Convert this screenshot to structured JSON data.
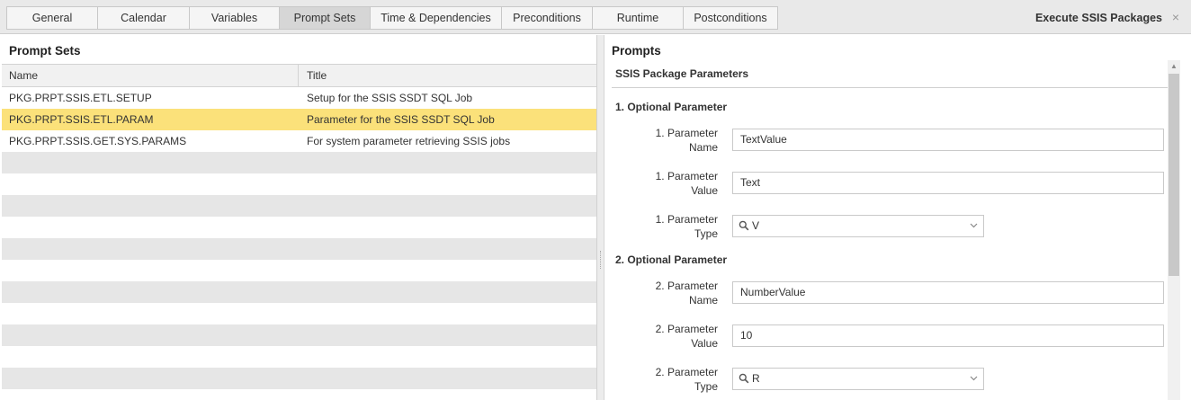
{
  "tabs": [
    {
      "label": "General"
    },
    {
      "label": "Calendar"
    },
    {
      "label": "Variables"
    },
    {
      "label": "Prompt Sets",
      "active": true
    },
    {
      "label": "Time & Dependencies"
    },
    {
      "label": "Preconditions"
    },
    {
      "label": "Runtime"
    },
    {
      "label": "Postconditions"
    }
  ],
  "window": {
    "title": "Execute SSIS Packages",
    "close_label": "×"
  },
  "prompt_sets": {
    "title": "Prompt Sets",
    "columns": {
      "name": "Name",
      "title": "Title"
    },
    "rows": [
      {
        "name": "PKG.PRPT.SSIS.ETL.SETUP",
        "title": "Setup for the SSIS SSDT SQL Job"
      },
      {
        "name": "PKG.PRPT.SSIS.ETL.PARAM",
        "title": "Parameter for the SSIS SSDT SQL Job",
        "selected": true
      },
      {
        "name": "PKG.PRPT.SSIS.GET.SYS.PARAMS",
        "title": "For system parameter retrieving SSIS jobs"
      }
    ]
  },
  "prompts": {
    "title": "Prompts",
    "group_title": "SSIS Package Parameters",
    "sections": [
      {
        "title": "1. Optional Parameter",
        "name_label": [
          "1. Parameter",
          "Name"
        ],
        "name_value": "TextValue",
        "value_label": [
          "1. Parameter",
          "Value"
        ],
        "value_value": "Text",
        "type_label": [
          "1. Parameter",
          "Type"
        ],
        "type_value": "V"
      },
      {
        "title": "2. Optional Parameter",
        "name_label": [
          "2. Parameter",
          "Name"
        ],
        "name_value": "NumberValue",
        "value_label": [
          "2. Parameter",
          "Value"
        ],
        "value_value": "10",
        "type_label": [
          "2. Parameter",
          "Type"
        ],
        "type_value": "R"
      }
    ]
  },
  "icons": {
    "close": "close-icon",
    "search": "search-icon",
    "dropdown": "chevron-down-icon",
    "scroll_up": "scroll-up-arrow-icon"
  },
  "colors": {
    "selected_row": "#fbe17a",
    "active_tab": "#d6d6d6",
    "stripe": "#e6e6e6"
  }
}
